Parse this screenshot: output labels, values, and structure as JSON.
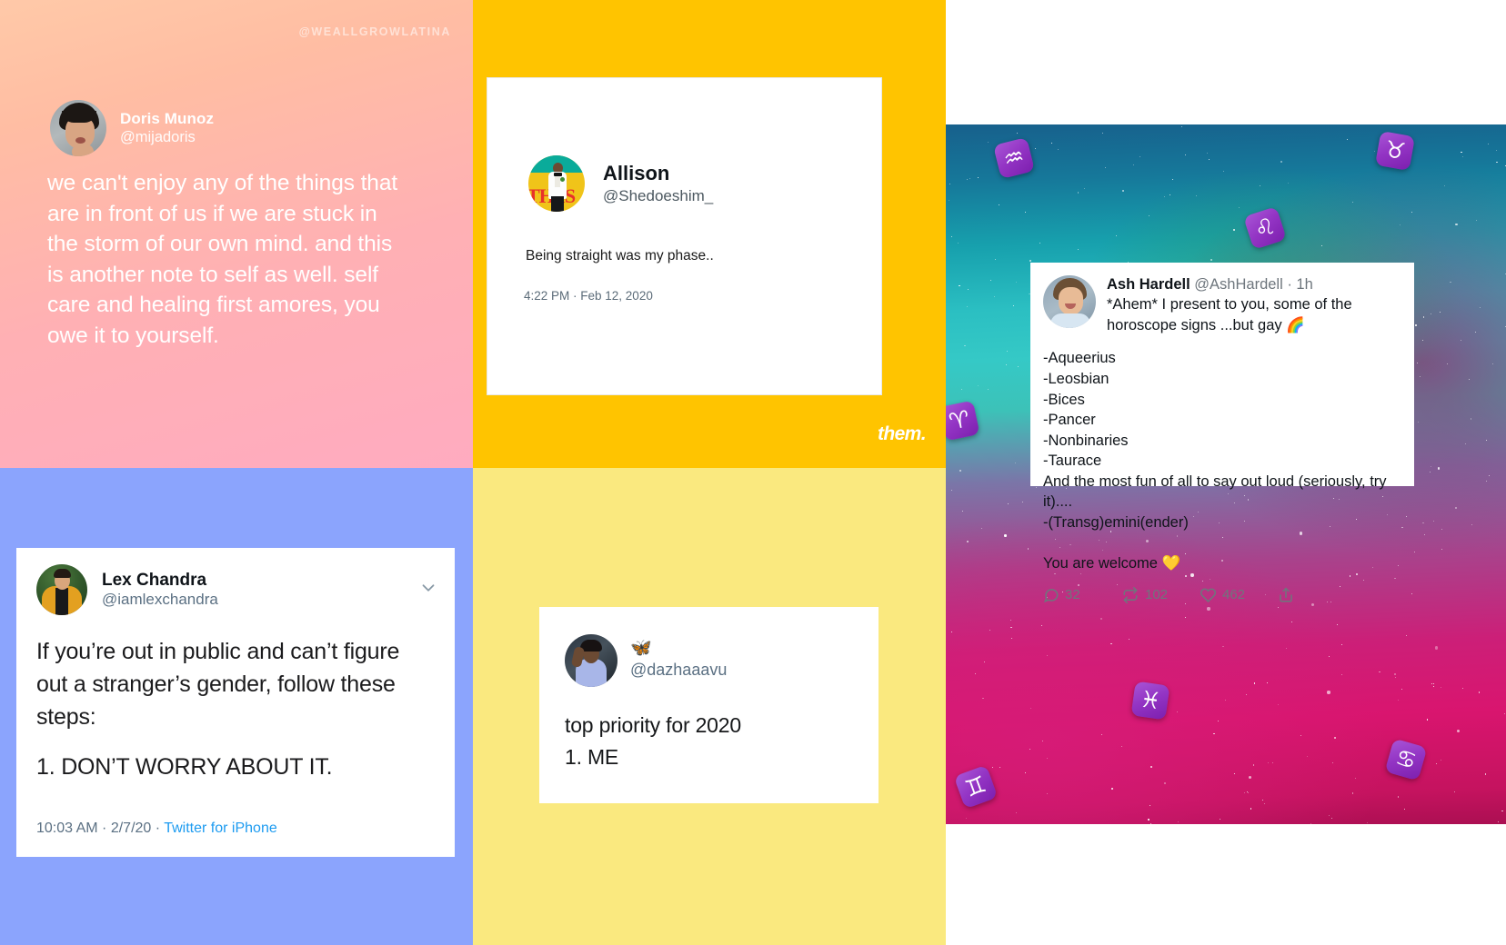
{
  "panels": {
    "doris": {
      "watermark": "@WEALLGROWLATINA",
      "name": "Doris Munoz",
      "handle": "@mijadoris",
      "body": "we can't enjoy any of the things that are in front of us if we are stuck in the storm of our own mind. and this is another note to self as well. self care and healing first amores, you owe it to yourself.",
      "bg_color": "#ffbda3"
    },
    "allison": {
      "name": "Allison",
      "handle": "@Shedoeshim_",
      "tweet": "Being straight was my phase..",
      "timestamp": "4:22 PM · Feb 12, 2020",
      "logo": "them.",
      "bg_color": "#ffc400"
    },
    "lex": {
      "name": "Lex Chandra",
      "handle": "@iamlexchandra",
      "body": "If you’re out in public and can’t figure out a stranger’s gender, follow these steps:",
      "step": "1. DON’T WORRY ABOUT IT.",
      "time": "10:03 AM · 2/7/20 · ",
      "source": "Twitter for iPhone",
      "caret_icon": "chevron-down-icon",
      "bg_color": "#8ba4fd"
    },
    "dazha": {
      "display_name": "🦋",
      "handle": "@dazhaaavu",
      "line1": "top priority for 2020",
      "line2": "1. ME",
      "bg_color": "#fae97f"
    },
    "ash": {
      "name": "Ash Hardell",
      "handle": "@AshHardell",
      "time": " · 1h",
      "body": "*Ahem* I present to you, some of the horoscope signs ...but gay 🌈",
      "list": "-Aqueerius\n-Leosbian\n-Bices\n-Pancer\n-Nonbinaries\n-Taurace\nAnd the most fun of all to say out loud (seriously, try it)....\n-(Transg)emini(ender)\n\nYou are welcome 💛",
      "replies": "32",
      "retweets": "102",
      "likes": "462",
      "share_icon": "share-icon",
      "reply_icon": "reply-icon",
      "retweet_icon": "retweet-icon",
      "like_icon": "heart-icon",
      "zodiac_signs": [
        "♒",
        "♉",
        "♌",
        "♈",
        "♓",
        "♊",
        "♋"
      ]
    }
  }
}
